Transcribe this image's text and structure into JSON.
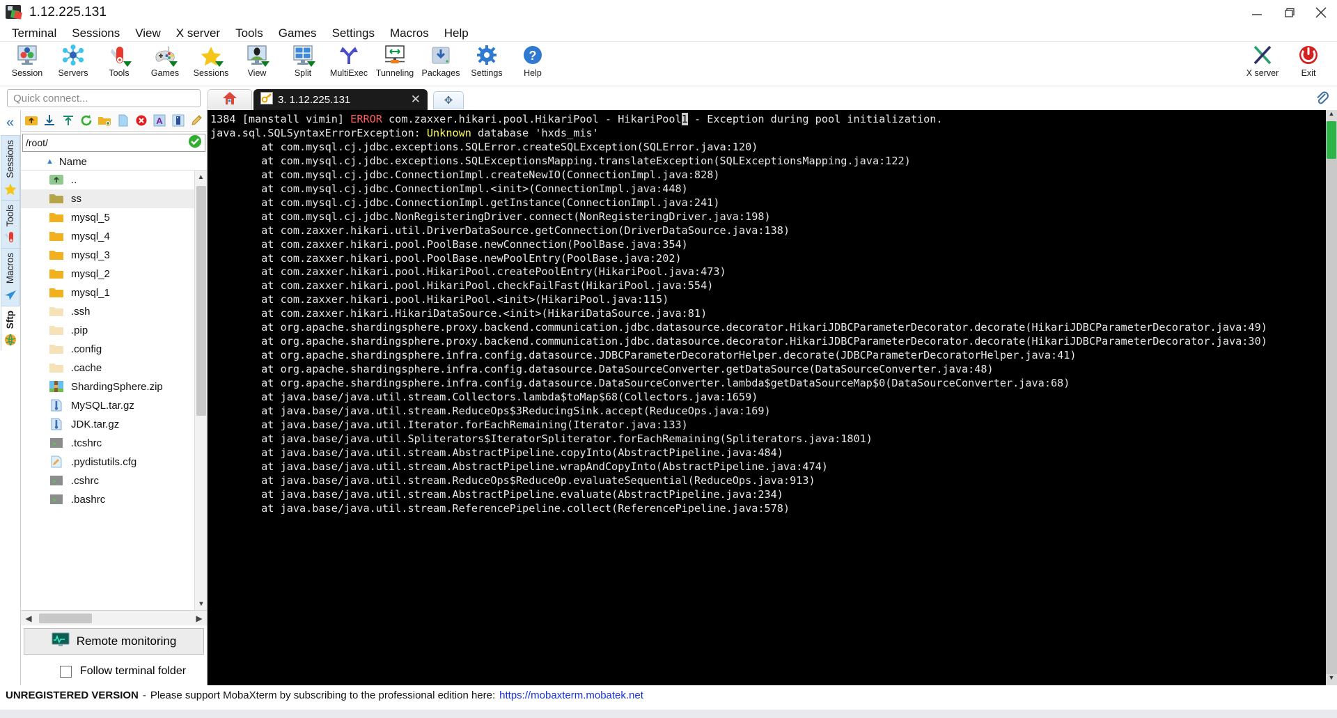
{
  "window": {
    "title": "1.12.225.131",
    "logo_icon": "mobaxterm-logo-icon",
    "minimize_icon": "minimize-icon",
    "restore_icon": "restore-icon",
    "close_icon": "close-icon"
  },
  "menu": {
    "items": [
      {
        "label": "Terminal"
      },
      {
        "label": "Sessions"
      },
      {
        "label": "View"
      },
      {
        "label": "X server"
      },
      {
        "label": "Tools"
      },
      {
        "label": "Games"
      },
      {
        "label": "Settings"
      },
      {
        "label": "Macros"
      },
      {
        "label": "Help"
      }
    ]
  },
  "toolbar": {
    "buttons": [
      {
        "label": "Session",
        "icon": "session-icon"
      },
      {
        "label": "Servers",
        "icon": "servers-icon"
      },
      {
        "label": "Tools",
        "icon": "tools-icon"
      },
      {
        "label": "Games",
        "icon": "games-icon"
      },
      {
        "label": "Sessions",
        "icon": "sessions-star-icon"
      },
      {
        "label": "View",
        "icon": "view-icon"
      },
      {
        "label": "Split",
        "icon": "split-icon"
      },
      {
        "label": "MultiExec",
        "icon": "multiexec-icon"
      },
      {
        "label": "Tunneling",
        "icon": "tunneling-icon"
      },
      {
        "label": "Packages",
        "icon": "packages-icon"
      },
      {
        "label": "Settings",
        "icon": "settings-gear-icon"
      },
      {
        "label": "Help",
        "icon": "help-icon"
      }
    ],
    "right_buttons": [
      {
        "label": "X server",
        "icon": "x-server-icon"
      },
      {
        "label": "Exit",
        "icon": "exit-power-icon"
      }
    ]
  },
  "quick_connect": {
    "placeholder": "Quick connect...",
    "value": ""
  },
  "tabs": {
    "home_icon": "home-icon",
    "items": [
      {
        "label": "3. 1.12.225.131",
        "icon": "ssh-key-icon",
        "active": true,
        "close_icon": "close-tab-icon"
      }
    ],
    "new_tab_icon": "new-tab-icon",
    "clip_icon": "paperclip-icon"
  },
  "left_ribbon": {
    "collapse_icon": "collapse-chevrons-icon",
    "tabs": [
      {
        "label": "Sessions",
        "icon": "star-icon",
        "selected": false
      },
      {
        "label": "Tools",
        "icon": "swiss-knife-icon",
        "selected": false
      },
      {
        "label": "Macros",
        "icon": "paper-plane-icon",
        "selected": false
      },
      {
        "label": "Sftp",
        "icon": "globe-icon",
        "selected": true
      }
    ]
  },
  "sftp": {
    "toolbar_icons": [
      "parent-folder-icon",
      "download-icon",
      "upload-icon",
      "refresh-icon",
      "new-folder-icon",
      "new-file-icon",
      "delete-icon",
      "text-mode-icon",
      "binary-mode-icon",
      "edit-icon"
    ],
    "path": "/root/",
    "path_ok_icon": "check-ok-icon",
    "column_header": "Name",
    "sort_caret_icon": "sort-asc-icon",
    "files": [
      {
        "name": "..",
        "icon": "parent-dir-icon",
        "selected": false
      },
      {
        "name": "ss",
        "icon": "folder-icon",
        "selected": true
      },
      {
        "name": "mysql_5",
        "icon": "folder-icon",
        "selected": false
      },
      {
        "name": "mysql_4",
        "icon": "folder-icon",
        "selected": false
      },
      {
        "name": "mysql_3",
        "icon": "folder-icon",
        "selected": false
      },
      {
        "name": "mysql_2",
        "icon": "folder-icon",
        "selected": false
      },
      {
        "name": "mysql_1",
        "icon": "folder-icon",
        "selected": false
      },
      {
        "name": ".ssh",
        "icon": "hidden-folder-icon",
        "selected": false
      },
      {
        "name": ".pip",
        "icon": "hidden-folder-icon",
        "selected": false
      },
      {
        "name": ".config",
        "icon": "hidden-folder-icon",
        "selected": false
      },
      {
        "name": ".cache",
        "icon": "hidden-folder-icon",
        "selected": false
      },
      {
        "name": "ShardingSphere.zip",
        "icon": "zip-icon",
        "selected": false
      },
      {
        "name": "MySQL.tar.gz",
        "icon": "targz-icon",
        "selected": false
      },
      {
        "name": "JDK.tar.gz",
        "icon": "targz-icon",
        "selected": false
      },
      {
        "name": ".tcshrc",
        "icon": "script-icon",
        "selected": false
      },
      {
        "name": ".pydistutils.cfg",
        "icon": "config-file-icon",
        "selected": false
      },
      {
        "name": ".cshrc",
        "icon": "script-icon",
        "selected": false
      },
      {
        "name": ".bashrc",
        "icon": "script-icon",
        "selected": false
      }
    ],
    "remote_monitoring_label": "Remote monitoring",
    "remote_monitoring_icon": "monitor-graph-icon",
    "follow_label": "Follow terminal folder",
    "follow_checked": false
  },
  "terminal": {
    "prefix": "1384 [manstall vimin] ",
    "error_word": "ERROR",
    "after_error": " com.zaxxer.hikari.pool.HikariPool - HikariPool",
    "cursor_char": "1",
    "line1_tail": " - Exception during pool initialization.",
    "line2_head": "java.sql.SQLSyntaxErrorException: ",
    "line2_yellow": "Unknown",
    "line2_tail": " database 'hxds_mis'",
    "body": "        at com.mysql.cj.jdbc.exceptions.SQLError.createSQLException(SQLError.java:120)\n        at com.mysql.cj.jdbc.exceptions.SQLExceptionsMapping.translateException(SQLExceptionsMapping.java:122)\n        at com.mysql.cj.jdbc.ConnectionImpl.createNewIO(ConnectionImpl.java:828)\n        at com.mysql.cj.jdbc.ConnectionImpl.<init>(ConnectionImpl.java:448)\n        at com.mysql.cj.jdbc.ConnectionImpl.getInstance(ConnectionImpl.java:241)\n        at com.mysql.cj.jdbc.NonRegisteringDriver.connect(NonRegisteringDriver.java:198)\n        at com.zaxxer.hikari.util.DriverDataSource.getConnection(DriverDataSource.java:138)\n        at com.zaxxer.hikari.pool.PoolBase.newConnection(PoolBase.java:354)\n        at com.zaxxer.hikari.pool.PoolBase.newPoolEntry(PoolBase.java:202)\n        at com.zaxxer.hikari.pool.HikariPool.createPoolEntry(HikariPool.java:473)\n        at com.zaxxer.hikari.pool.HikariPool.checkFailFast(HikariPool.java:554)\n        at com.zaxxer.hikari.pool.HikariPool.<init>(HikariPool.java:115)\n        at com.zaxxer.hikari.HikariDataSource.<init>(HikariDataSource.java:81)\n        at org.apache.shardingsphere.proxy.backend.communication.jdbc.datasource.decorator.HikariJDBCParameterDecorator.decorate(HikariJDBCParameterDecorator.java:49)\n        at org.apache.shardingsphere.proxy.backend.communication.jdbc.datasource.decorator.HikariJDBCParameterDecorator.decorate(HikariJDBCParameterDecorator.java:30)\n        at org.apache.shardingsphere.infra.config.datasource.JDBCParameterDecoratorHelper.decorate(JDBCParameterDecoratorHelper.java:41)\n        at org.apache.shardingsphere.infra.config.datasource.DataSourceConverter.getDataSource(DataSourceConverter.java:48)\n        at org.apache.shardingsphere.infra.config.datasource.DataSourceConverter.lambda$getDataSourceMap$0(DataSourceConverter.java:68)\n        at java.base/java.util.stream.Collectors.lambda$toMap$68(Collectors.java:1659)\n        at java.base/java.util.stream.ReduceOps$3ReducingSink.accept(ReduceOps.java:169)\n        at java.base/java.util.Iterator.forEachRemaining(Iterator.java:133)\n        at java.base/java.util.Spliterators$IteratorSpliterator.forEachRemaining(Spliterators.java:1801)\n        at java.base/java.util.stream.AbstractPipeline.copyInto(AbstractPipeline.java:484)\n        at java.base/java.util.stream.AbstractPipeline.wrapAndCopyInto(AbstractPipeline.java:474)\n        at java.base/java.util.stream.ReduceOps$ReduceOp.evaluateSequential(ReduceOps.java:913)\n        at java.base/java.util.stream.AbstractPipeline.evaluate(AbstractPipeline.java:234)\n        at java.base/java.util.stream.ReferencePipeline.collect(ReferencePipeline.java:578)",
    "colors": {
      "background": "#000000",
      "foreground": "#e6e6e6",
      "error": "#ff5f5f",
      "highlight": "#ffff55",
      "scrollbar_thumb": "#2fb44a"
    }
  },
  "status_bar": {
    "unregistered": "UNREGISTERED VERSION",
    "dash": "-",
    "message": "Please support MobaXterm by subscribing to the professional edition here:",
    "link": "https://mobaxterm.mobatek.net"
  }
}
